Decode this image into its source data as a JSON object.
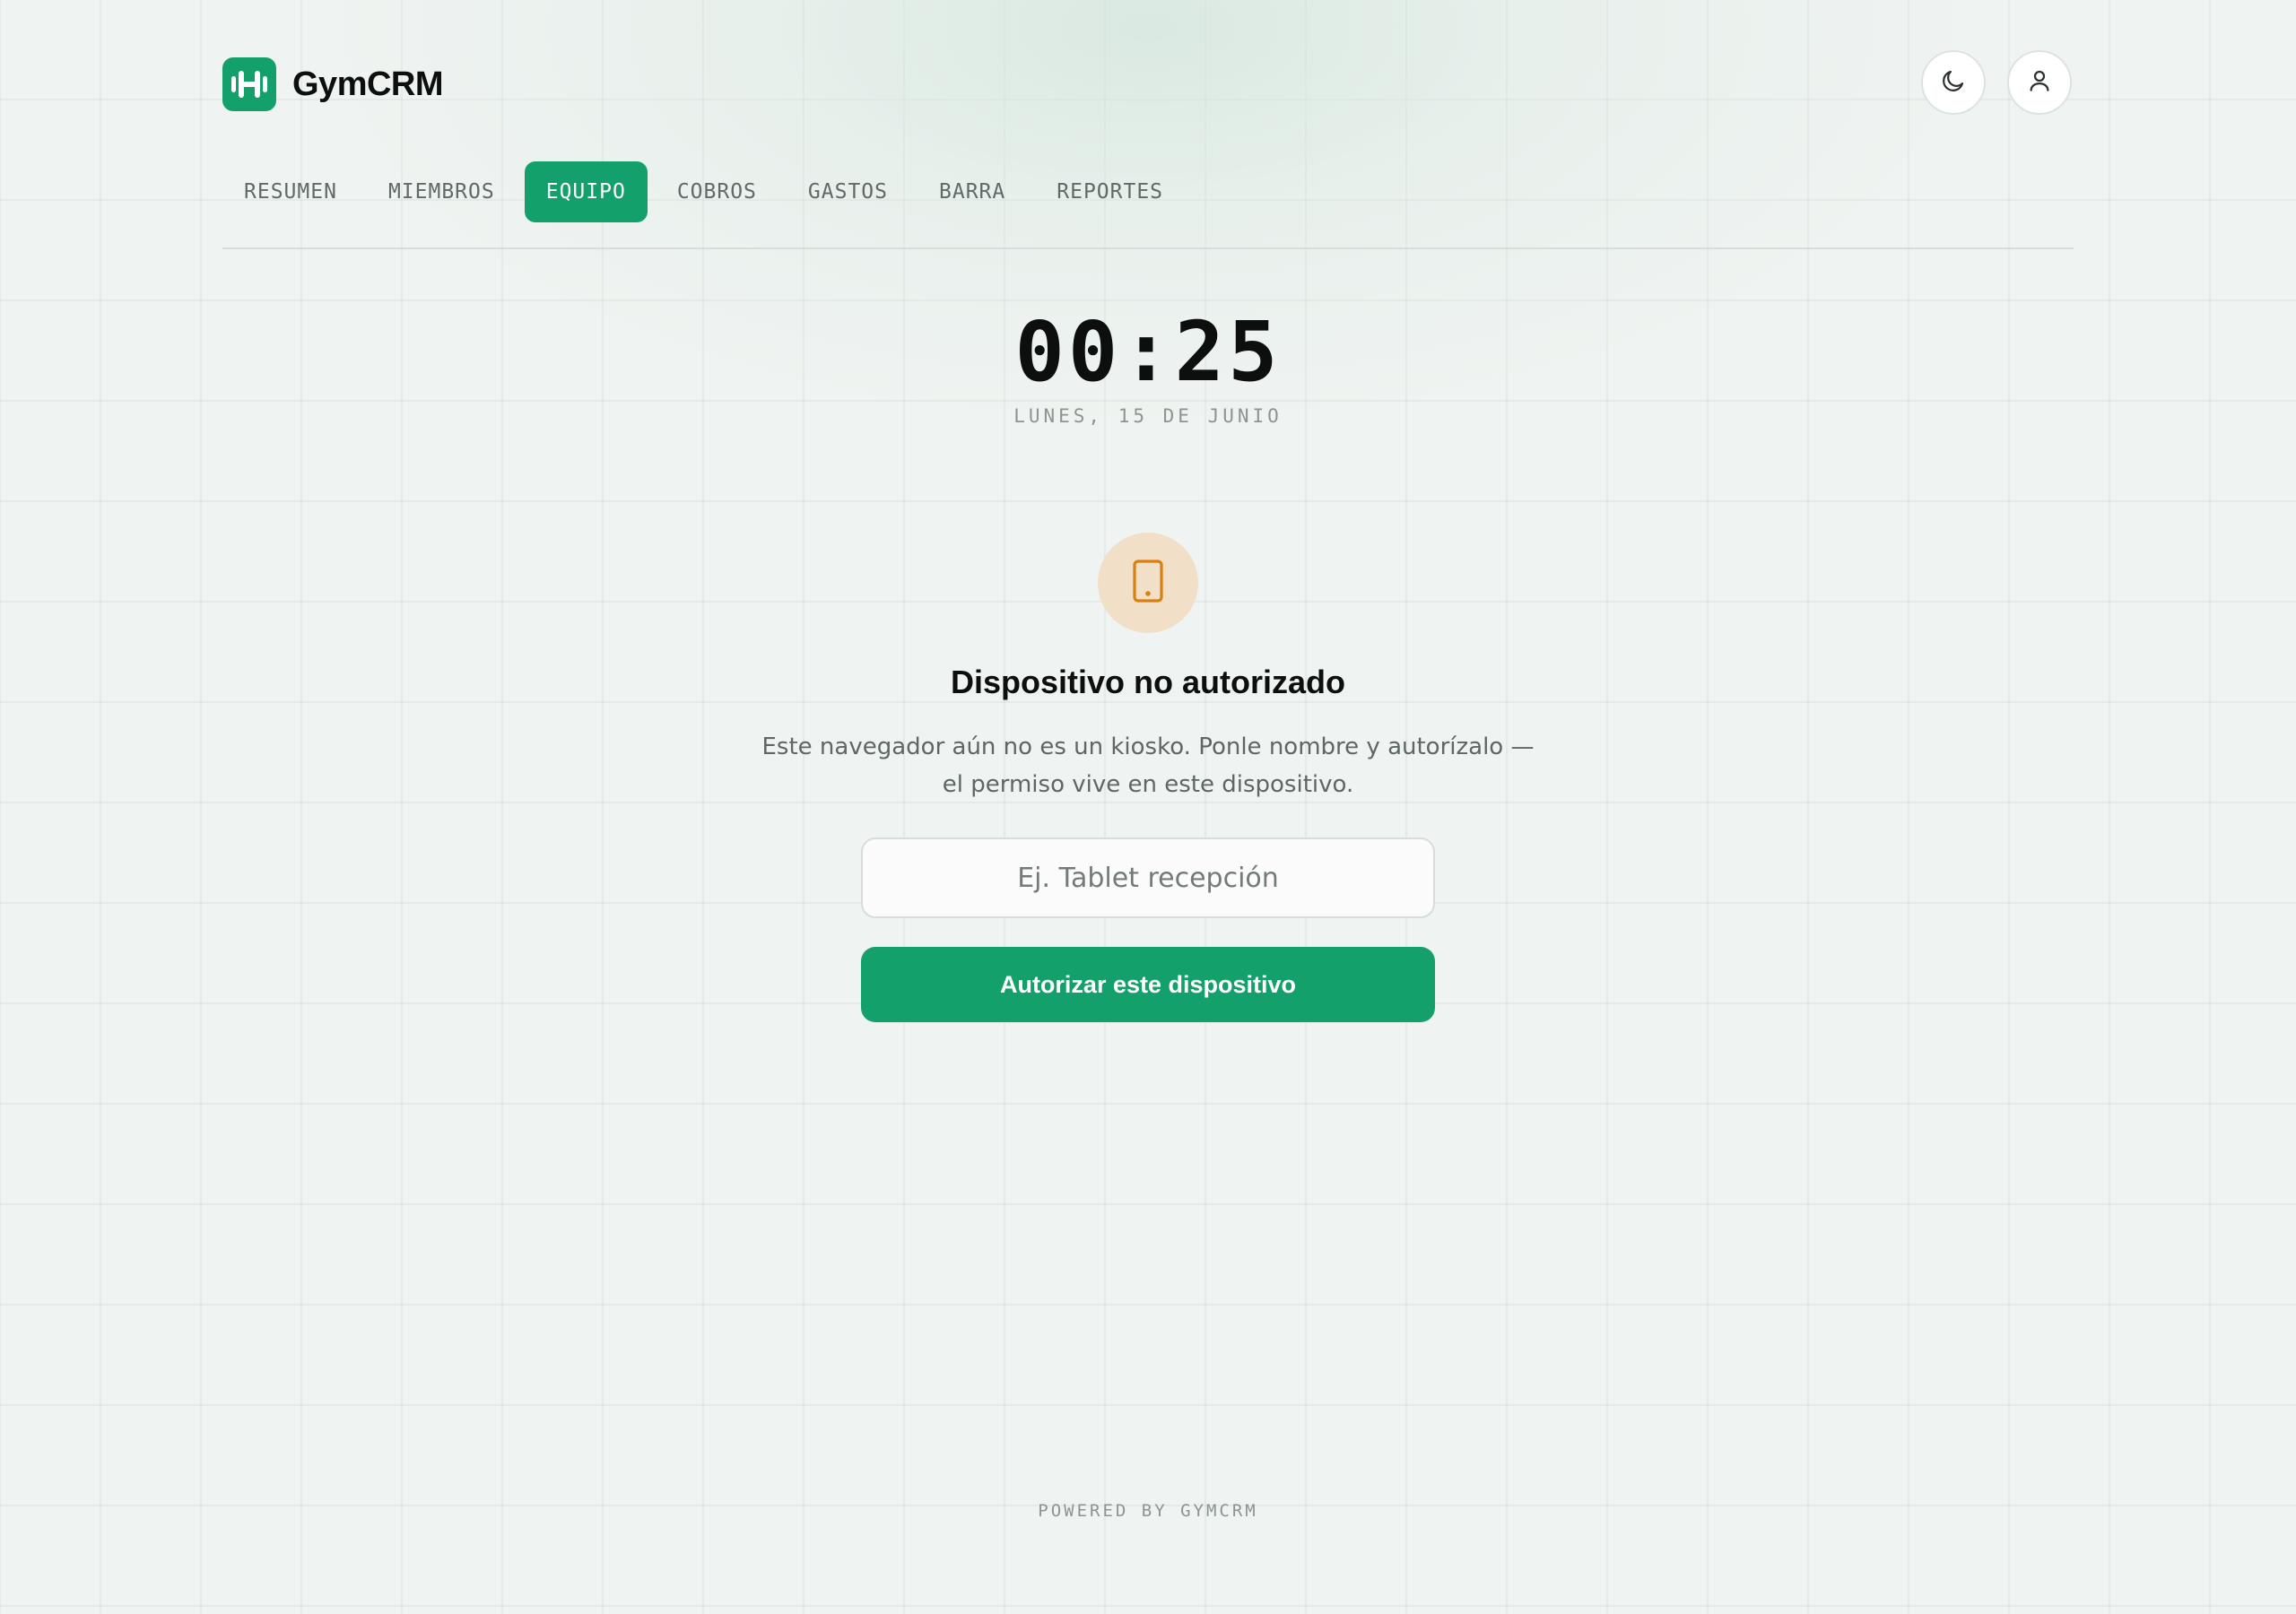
{
  "app": {
    "brand_name": "GymCRM",
    "icons": {
      "logo": "dumbbell-logo-icon",
      "theme_toggle": "moon-icon",
      "user": "user-icon",
      "device": "tablet-icon"
    },
    "colors": {
      "accent": "#14a06b",
      "warning": "#d9800f",
      "warning_bg": "#f2dfc8",
      "background": "#eff3f1"
    }
  },
  "nav": {
    "tabs": [
      {
        "label": "RESUMEN",
        "active": false
      },
      {
        "label": "MIEMBROS",
        "active": false
      },
      {
        "label": "EQUIPO",
        "active": true
      },
      {
        "label": "COBROS",
        "active": false
      },
      {
        "label": "GASTOS",
        "active": false
      },
      {
        "label": "BARRA",
        "active": false
      },
      {
        "label": "REPORTES",
        "active": false
      }
    ]
  },
  "clock": {
    "time": "00:25",
    "date": "LUNES, 15 DE JUNIO"
  },
  "device": {
    "title": "Dispositivo no autorizado",
    "description": "Este navegador aún no es un kiosko. Ponle nombre y autorízalo — el permiso vive en este dispositivo.",
    "input_placeholder": "Ej. Tablet recepción",
    "input_value": "",
    "authorize_label": "Autorizar este dispositivo"
  },
  "footer": {
    "text": "POWERED BY GYMCRM"
  }
}
